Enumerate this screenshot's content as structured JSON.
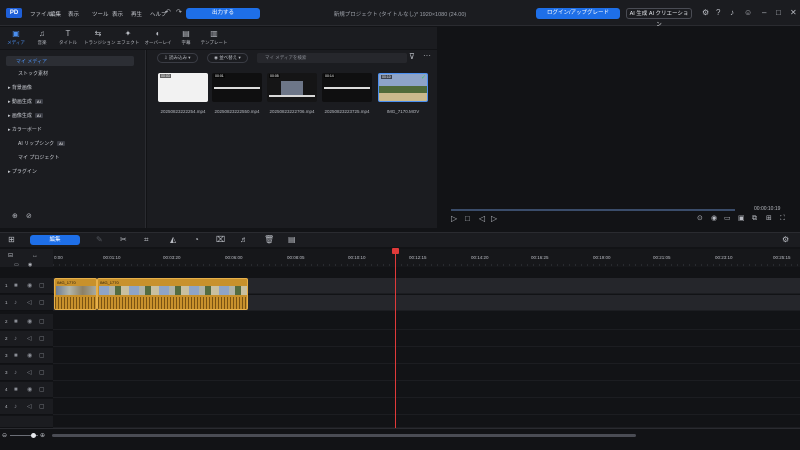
{
  "titlebar": {
    "logo": "PD",
    "menus": [
      "ファイル",
      "編集",
      "表示",
      "ツール",
      "表示",
      "再生",
      "ヘルプ"
    ],
    "export_label": "出力する",
    "project_title": "新規プロジェクト (タイトルなし)* 1920×1080 (24.00)",
    "upgrade_label": "ログイン/アップグレード",
    "ai_label": "AI 生成 AI クリエーション"
  },
  "tooltabs": [
    {
      "glyph": "▣",
      "label": "メディア",
      "active": true
    },
    {
      "glyph": "♫",
      "label": "音楽"
    },
    {
      "glyph": "T",
      "label": "タイトル"
    },
    {
      "glyph": "⇆",
      "label": "トランジション"
    },
    {
      "glyph": "✦",
      "label": "エフェクト"
    },
    {
      "glyph": "◐",
      "label": "オーバーレイ"
    },
    {
      "glyph": "▤",
      "label": "字幕"
    },
    {
      "glyph": "▥",
      "label": "テンプレート"
    }
  ],
  "sidebar": {
    "items": [
      {
        "label": "マイ メディア",
        "selected": true
      },
      {
        "label": "ストック素材"
      },
      {
        "label": "背景画像",
        "arrow": true
      },
      {
        "label": "動画生成",
        "arrow": true,
        "ai": true
      },
      {
        "label": "画像生成",
        "arrow": true,
        "ai": true
      },
      {
        "label": "カラーボード",
        "arrow": true
      },
      {
        "label": "AI リップシンク",
        "ai": true
      },
      {
        "label": "マイ プロジェクト"
      },
      {
        "label": "プラグイン",
        "arrow": true
      }
    ],
    "ai_badge": "AI"
  },
  "media": {
    "import_label": "読み込み",
    "sort_label": "並べ替え",
    "search_placeholder": "マイ メディアを検索",
    "items": [
      {
        "name": "20250823222254.mp4",
        "duration": "00:03"
      },
      {
        "name": "20250823222550.mp4",
        "duration": "00:01"
      },
      {
        "name": "20250823222706.mp4",
        "duration": "00:05"
      },
      {
        "name": "20250823223725.mp4",
        "duration": "00:14"
      },
      {
        "name": "IMG_7170.MOV",
        "duration": "00:10"
      }
    ]
  },
  "preview": {
    "timecode": "00:00:10:19"
  },
  "timeline": {
    "edit_label": "編集",
    "ruler_ticks": [
      "0:00",
      "00:01:10",
      "00:03:20",
      "00:06:00",
      "00:08:05",
      "00:10:10",
      "00:12:15",
      "00:14:20",
      "00:16:25",
      "00:19:00",
      "00:21:05",
      "00:23:10",
      "00:25:15"
    ],
    "clip1_label": "IMG_1770",
    "clip2_label": "IMG_1770",
    "tracks": [
      "1",
      "1",
      "2",
      "2",
      "3",
      "3",
      "4",
      "4"
    ]
  },
  "colors": {
    "accent": "#1e6fe8",
    "clip": "#c8912c",
    "playhead": "#e03a3a"
  }
}
